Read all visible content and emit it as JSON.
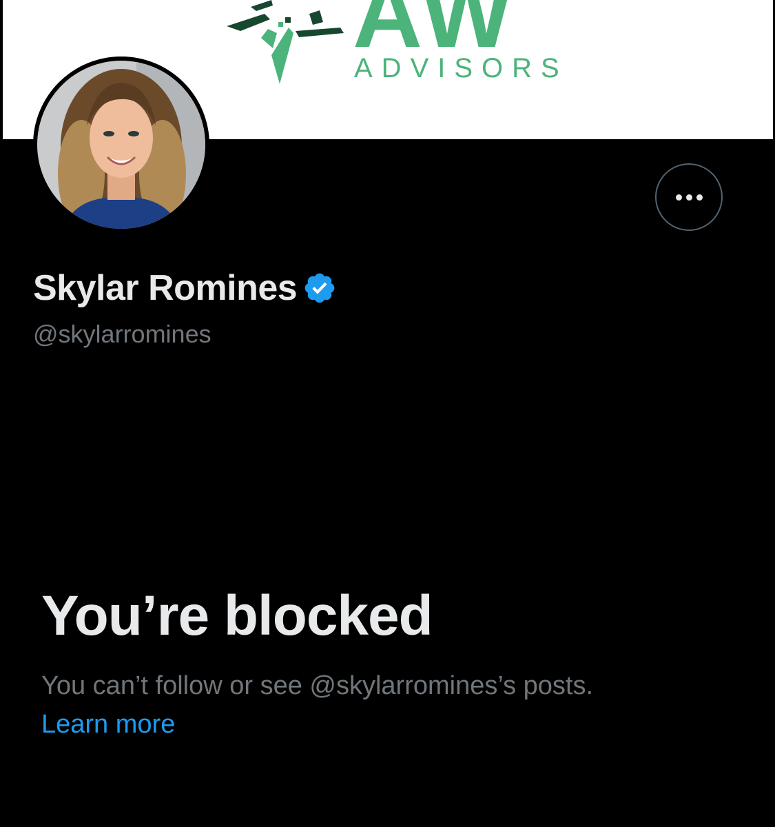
{
  "banner": {
    "logo_letters": "AW",
    "logo_subtitle": "ADVISORS",
    "logo_icon": "arrows-logo-icon",
    "colors": {
      "green": "#4cb37a",
      "dark_green": "#16472f",
      "background": "#ffffff"
    }
  },
  "profile": {
    "display_name": "Skylar Romines",
    "handle": "@skylarromines",
    "verified_icon": "verified-badge-icon",
    "avatar_icon": "profile-photo",
    "more_icon": "more-options-icon"
  },
  "blocked": {
    "title": "You’re blocked",
    "description": "You can’t follow or see @skylarromines’s posts.",
    "learn_more": "Learn more"
  },
  "colors": {
    "background": "#000000",
    "primary_text": "#e7e9ea",
    "secondary_text": "#71767b",
    "link": "#1d9bf0",
    "verified": "#1d9bf0",
    "button_border": "#536471"
  }
}
